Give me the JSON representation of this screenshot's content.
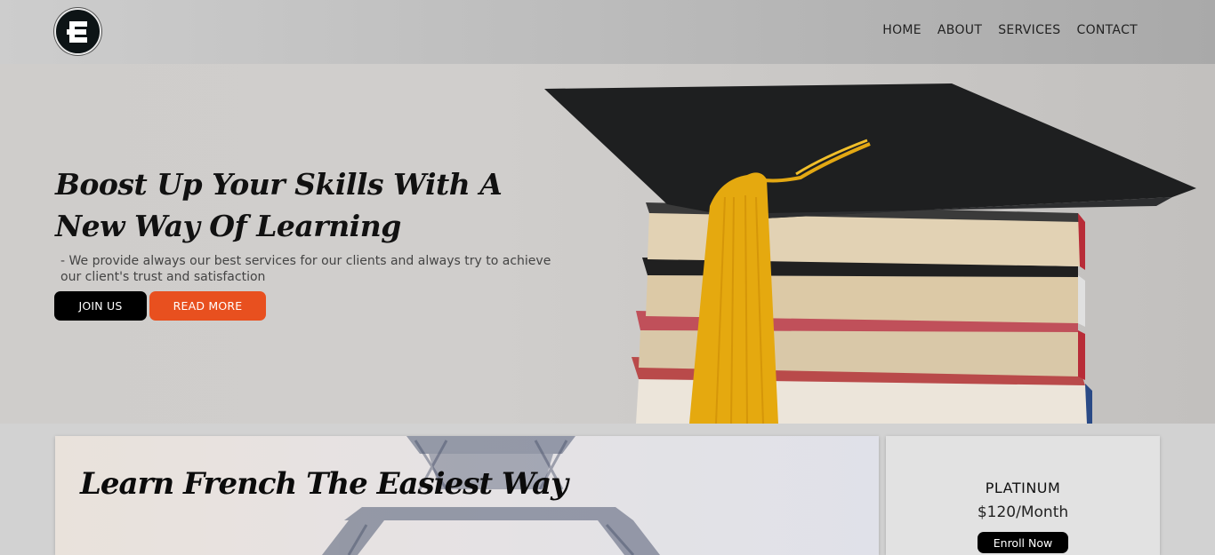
{
  "nav": {
    "logo_icon": "e-logo-icon",
    "links": [
      "HOME",
      "ABOUT",
      "SERVICES",
      "CONTACT"
    ]
  },
  "hero": {
    "title_line1": "Boost Up Your Skills With A",
    "title_line2": "New Way Of Learning",
    "subtitle_line1": "- We provide always our best services for our clients and always try to achieve",
    "subtitle_line2": "our client's trust and satisfaction",
    "join_label": "JOIN US",
    "read_more_label": "READ MORE",
    "image": "graduation-cap-on-books"
  },
  "feature": {
    "title": "Learn French The Easiest Way",
    "image": "eiffel-tower"
  },
  "pricing": {
    "plan_name": "PLATINUM",
    "price": "$120/Month",
    "enroll_label": "Enroll Now"
  },
  "colors": {
    "accent": "#e8501f",
    "dark": "#000000",
    "nav_text": "#222222"
  }
}
